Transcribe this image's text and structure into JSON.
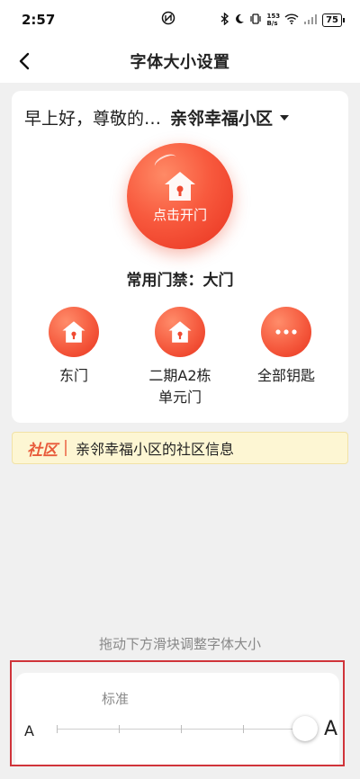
{
  "status_bar": {
    "time": "2:57",
    "net_speed_value": "153",
    "net_speed_unit": "B/s",
    "battery": "75"
  },
  "nav": {
    "title": "字体大小设置"
  },
  "card": {
    "greeting": "早上好，尊敬的…",
    "community": "亲邻幸福小区",
    "open_button_label": "点击开门",
    "common_gate": "常用门禁：大门",
    "keys": [
      {
        "label": "东门"
      },
      {
        "label": "二期A2栋\n单元门"
      },
      {
        "label": "全部钥匙"
      }
    ]
  },
  "notice": {
    "tag": "社区",
    "text": "亲邻幸福小区的社区信息"
  },
  "font_size": {
    "hint": "拖动下方滑块调整字体大小",
    "current_level_label": "标准",
    "small_a": "A",
    "large_a": "A",
    "levels": 5,
    "selected_level_index": 4
  },
  "colors": {
    "accent": "#f0533a",
    "highlight_border": "#d0343a",
    "notice_bg": "#fdf6d3"
  }
}
